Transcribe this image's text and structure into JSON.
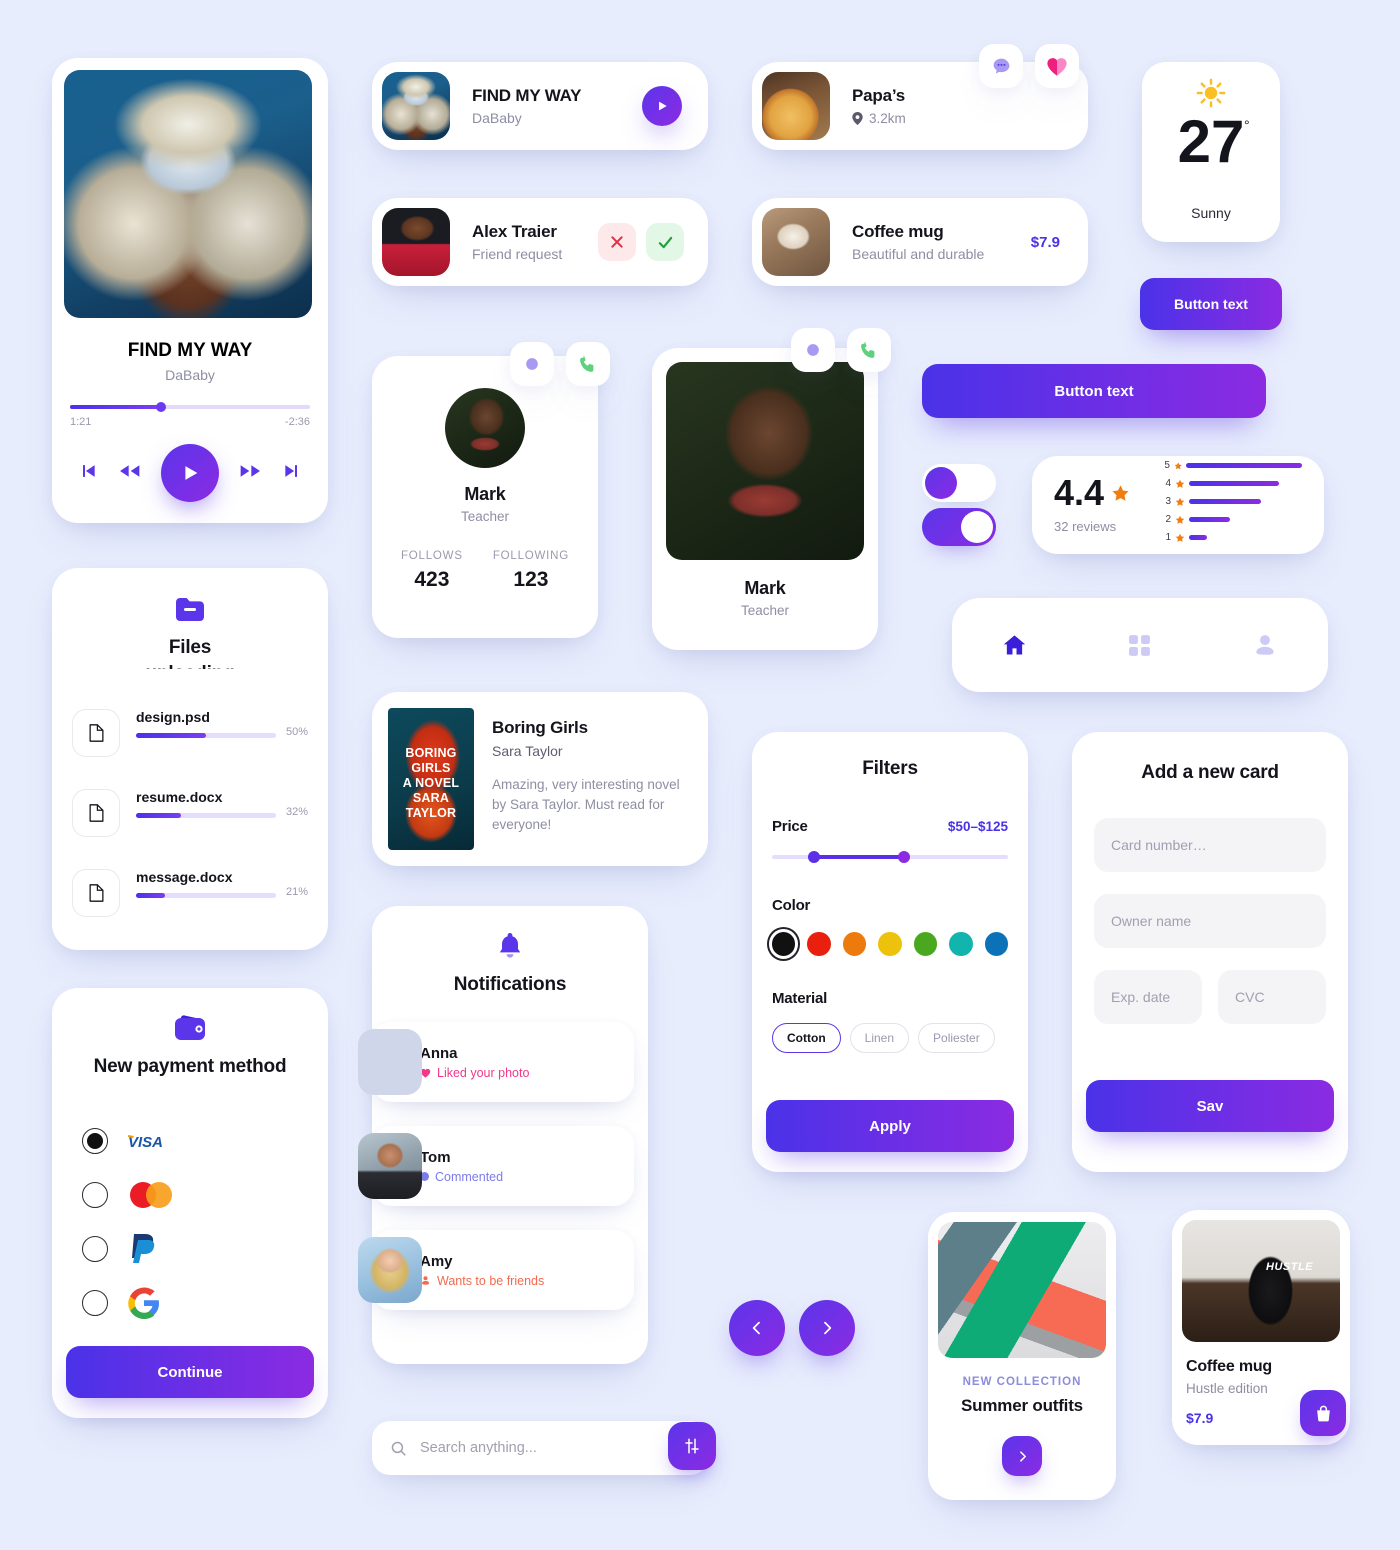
{
  "theme": {
    "bg": "#e8edfd",
    "accent_start": "#4a32e8",
    "accent_end": "#8b2be2",
    "accent": "#5b35ea",
    "text": "#14141c",
    "muted": "#8e8ea3"
  },
  "player": {
    "title": "FIND MY WAY",
    "artist": "DaBaby",
    "elapsed": "1:21",
    "remaining": "-2:36",
    "progress_pct": 38,
    "icons": {
      "prev": "skip-back-icon",
      "rewind": "rewind-icon",
      "play": "play-icon",
      "forward": "fast-forward-icon",
      "next": "skip-forward-icon"
    }
  },
  "song_row": {
    "title": "FIND MY WAY",
    "artist": "DaBaby",
    "play_icon": "play-icon"
  },
  "friend_row": {
    "name": "Alex Traier",
    "subtitle": "Friend request",
    "decline_icon": "close-icon",
    "accept_icon": "check-icon"
  },
  "place_row": {
    "name": "Papa’s",
    "distance": "3.2km",
    "pin_icon": "map-pin-icon",
    "chat_icon": "chat-bubble-icon",
    "like_icon": "heart-icon"
  },
  "product_row": {
    "title": "Coffee mug",
    "subtitle": "Beautiful and durable",
    "price": "$7.9"
  },
  "weather": {
    "icon": "sun-icon",
    "temperature": "27",
    "degree_symbol": "°",
    "condition": "Sunny"
  },
  "buttons": {
    "small": "Button text",
    "wide": "Button text"
  },
  "profile_stats": {
    "name": "Mark",
    "role": "Teacher",
    "follows_label": "FOLLOWS",
    "follows_value": "423",
    "following_label": "FOLLOWING",
    "following_value": "123",
    "chat_icon": "chat-bubble-icon",
    "call_icon": "phone-icon"
  },
  "profile_photo": {
    "name": "Mark",
    "role": "Teacher",
    "chat_icon": "chat-bubble-icon",
    "call_icon": "phone-icon"
  },
  "rating": {
    "score": "4.4",
    "star_icon": "star-icon",
    "reviews": "32 reviews",
    "breakdown": [
      {
        "stars": "5",
        "pct": 100
      },
      {
        "stars": "4",
        "pct": 65
      },
      {
        "stars": "3",
        "pct": 52
      },
      {
        "stars": "2",
        "pct": 30
      },
      {
        "stars": "1",
        "pct": 13
      }
    ]
  },
  "toggles": {
    "off_state": "off",
    "on_state": "on"
  },
  "navbar": {
    "items": [
      {
        "icon": "home-icon",
        "active": true
      },
      {
        "icon": "grid-icon",
        "active": false
      },
      {
        "icon": "user-icon",
        "active": false
      }
    ]
  },
  "files": {
    "icon": "folder-icon",
    "title_line1": "Files",
    "title_line2": "uploading",
    "items": [
      {
        "name": "design.psd",
        "pct_label": "50%",
        "pct": 50
      },
      {
        "name": "resume.docx",
        "pct_label": "32%",
        "pct": 32
      },
      {
        "name": "message.docx",
        "pct_label": "21%",
        "pct": 21
      }
    ]
  },
  "payment": {
    "icon": "wallet-icon",
    "title": "New payment method",
    "methods": [
      {
        "name": "visa-logo",
        "selected": true
      },
      {
        "name": "mastercard-logo",
        "selected": false
      },
      {
        "name": "paypal-logo",
        "selected": false
      },
      {
        "name": "google-pay-logo",
        "selected": false
      }
    ],
    "continue_label": "Continue"
  },
  "book": {
    "title": "Boring Girls",
    "author": "Sara Taylor",
    "review": "Amazing, very interesting novel by Sara Taylor. Must read for everyone!",
    "cover_lines": [
      "BORING",
      "GIRLS",
      "A NOVEL",
      "SARA",
      "TAYLOR"
    ]
  },
  "notifications": {
    "icon": "bell-icon",
    "title": "Notifications",
    "items": [
      {
        "name": "Anna",
        "action": "Liked your photo",
        "color": "#f1398c",
        "icon": "heart-icon"
      },
      {
        "name": "Tom",
        "action": "Commented",
        "color": "#7b7ce8",
        "icon": "comment-dot-icon"
      },
      {
        "name": "Amy",
        "action": "Wants to be friends",
        "color": "#f26a4f",
        "icon": "person-add-icon"
      }
    ]
  },
  "filters": {
    "title": "Filters",
    "price_label": "Price",
    "price_value": "$50–$125",
    "price_min_pct": 18,
    "price_max_pct": 56,
    "color_label": "Color",
    "colors": [
      {
        "hex": "#111111",
        "selected": true
      },
      {
        "hex": "#e8200d",
        "selected": false
      },
      {
        "hex": "#ec7a0c",
        "selected": false
      },
      {
        "hex": "#edc20c",
        "selected": false
      },
      {
        "hex": "#4aa81e",
        "selected": false
      },
      {
        "hex": "#11b5ae",
        "selected": false
      },
      {
        "hex": "#0c72b8",
        "selected": false
      }
    ],
    "material_label": "Material",
    "materials": [
      {
        "label": "Cotton",
        "selected": true
      },
      {
        "label": "Linen",
        "selected": false
      },
      {
        "label": "Poliester",
        "selected": false
      }
    ],
    "apply_label": "Apply"
  },
  "add_card": {
    "title": "Add a new card",
    "card_number_placeholder": "Card number…",
    "owner_placeholder": "Owner name",
    "exp_placeholder": "Exp. date",
    "cvc_placeholder": "CVC",
    "save_label": "Sav"
  },
  "carousel": {
    "prev_icon": "chevron-left-icon",
    "next_icon": "chevron-right-icon"
  },
  "search": {
    "placeholder": "Search anything...",
    "search_icon": "search-icon",
    "filter_icon": "sliders-icon"
  },
  "collection_card": {
    "eyebrow": "NEW COLLECTION",
    "title": "Summer outfits",
    "next_icon": "chevron-right-icon"
  },
  "mug_card": {
    "title": "Coffee mug",
    "subtitle": "Hustle edition",
    "price": "$7.9",
    "cart_icon": "shopping-bag-icon",
    "mug_text": "HUSTLE"
  }
}
